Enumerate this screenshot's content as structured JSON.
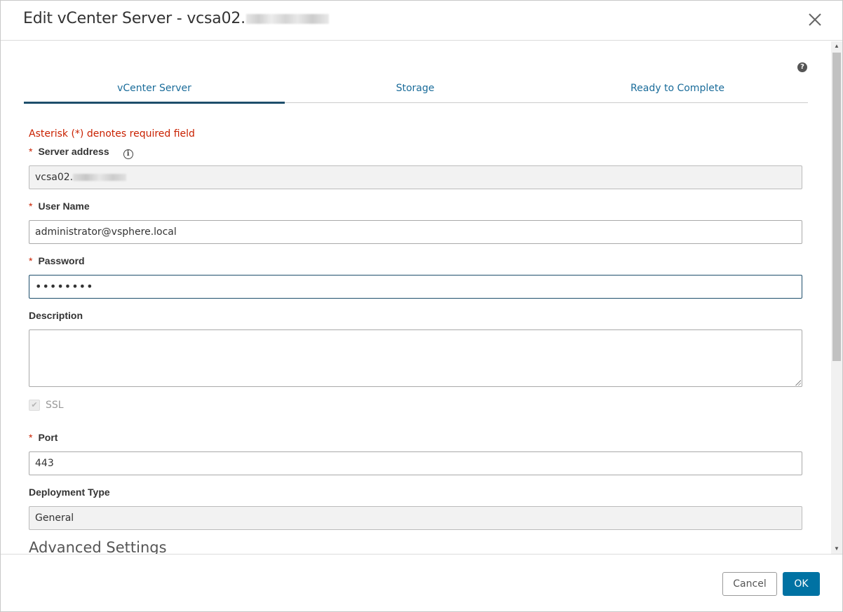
{
  "dialog": {
    "title": "Edit vCenter Server - vcsa02.",
    "close_icon": "close-icon"
  },
  "tabs": [
    {
      "label": "vCenter Server",
      "active": true
    },
    {
      "label": "Storage",
      "active": false
    },
    {
      "label": "Ready to Complete",
      "active": false
    }
  ],
  "help_icon": "?",
  "form": {
    "required_note": "Asterisk (*) denotes required field",
    "server_address": {
      "label": "Server address",
      "value": "vcsa02.",
      "required": true
    },
    "user_name": {
      "label": "User Name",
      "value": "administrator@vsphere.local",
      "required": true
    },
    "password": {
      "label": "Password",
      "value": "••••••••",
      "required": true
    },
    "description": {
      "label": "Description",
      "value": ""
    },
    "ssl": {
      "label": "SSL",
      "checked": true,
      "disabled": true
    },
    "port": {
      "label": "Port",
      "value": "443",
      "required": true
    },
    "deployment_type": {
      "label": "Deployment Type",
      "value": "General"
    },
    "advanced_settings": "Advanced Settings",
    "required_marker": "*"
  },
  "footer": {
    "cancel_label": "Cancel",
    "ok_label": "OK"
  },
  "colors": {
    "accent": "#0072a3",
    "tab_text": "#1a6c9a",
    "required": "#c92100"
  }
}
